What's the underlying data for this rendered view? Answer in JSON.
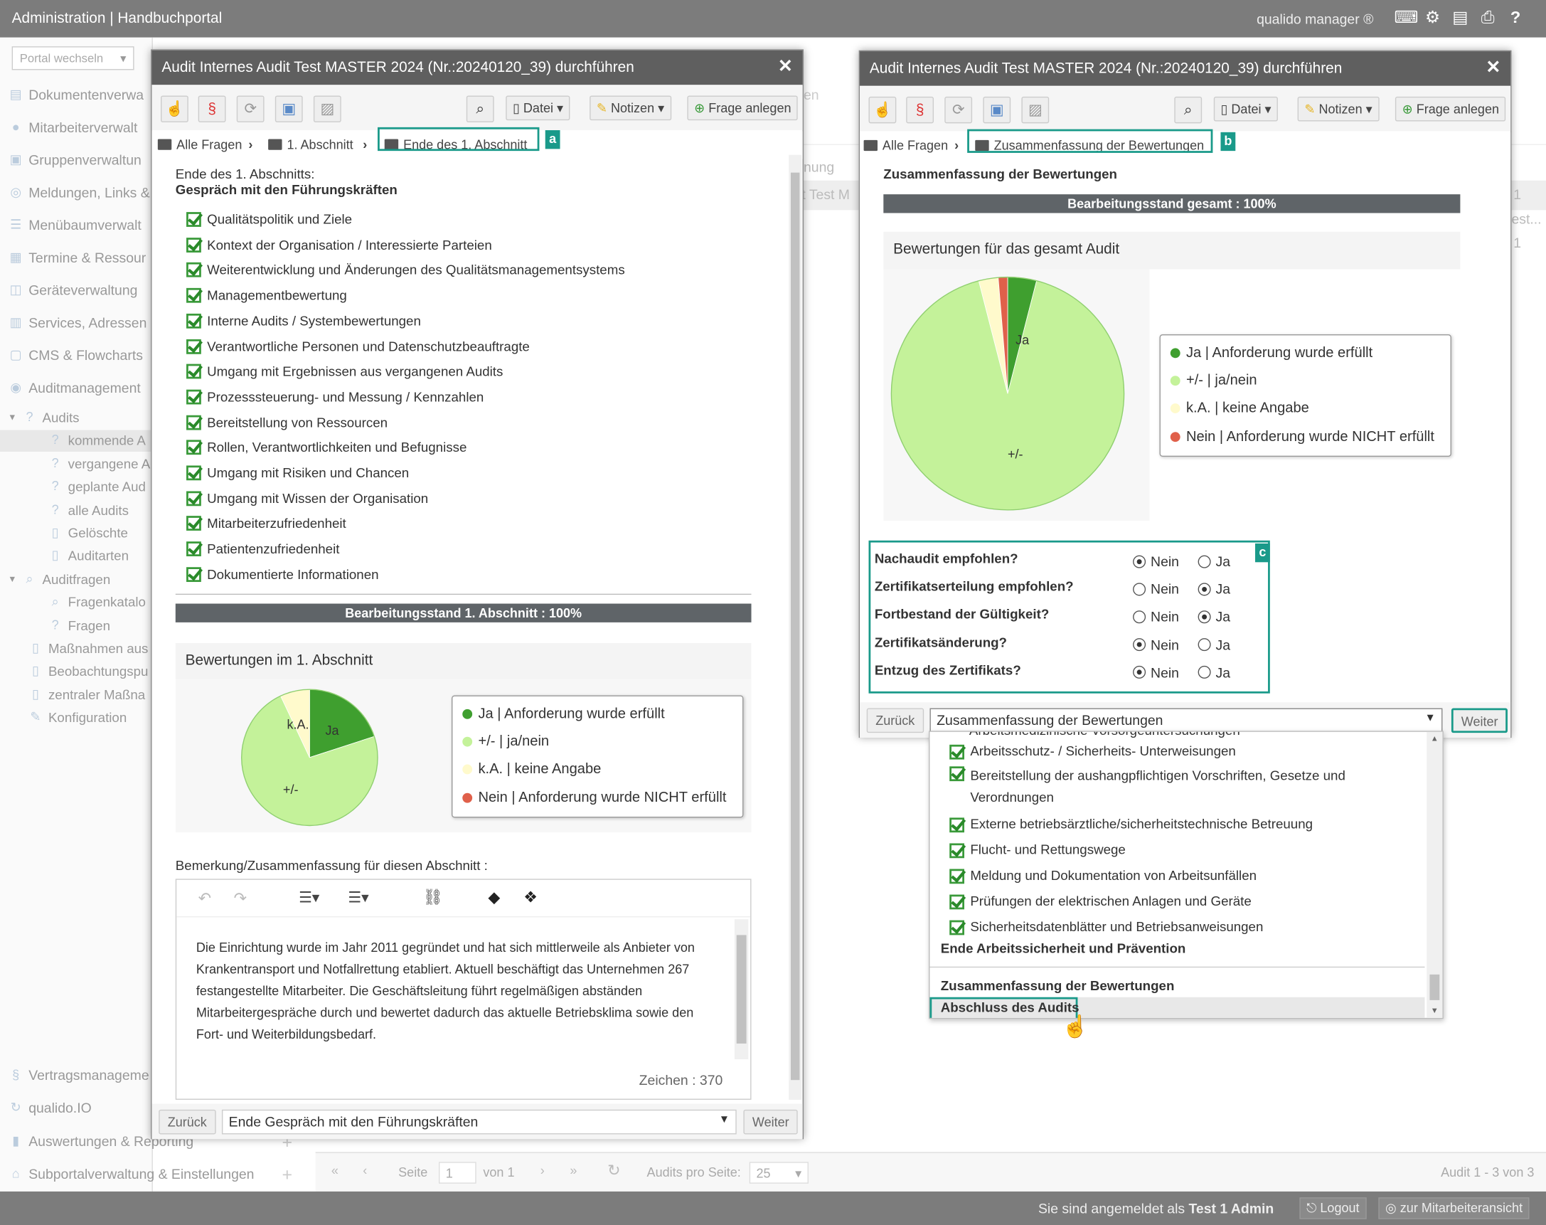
{
  "app": {
    "title": "Administration | Handbuchportal",
    "brand": "qualido manager ®"
  },
  "sidebar": {
    "portal_select": "Portal wechseln",
    "items": [
      "Dokumentenverwa",
      "Mitarbeiterverwalt",
      "Gruppenverwaltun",
      "Meldungen, Links &",
      "Menübaumverwalt",
      "Termine & Ressour",
      "Geräteverwaltung",
      "Services, Adressen",
      "CMS & Flowcharts",
      "Auditmanagement"
    ],
    "audits": "Audits",
    "audit_subs": [
      "kommende A",
      "vergangene A",
      "geplante Aud",
      "alle Audits",
      "Gelöschte",
      "Auditarten"
    ],
    "auditfragen": "Auditfragen",
    "auditfragen_subs": [
      "Fragenkatalo",
      "Fragen"
    ],
    "more": [
      "Maßnahmen aus",
      "Beobachtungspu",
      "zentraler Maßna",
      "Konfiguration"
    ],
    "bottom": [
      "Vertragsmanageme",
      "qualido.IO",
      "Auswertungen & Reporting",
      "Subportalverwaltung & Einstellungen"
    ]
  },
  "background": {
    "col_hint": "nung",
    "cell_hint": "it Test M",
    "num1": "1",
    "text2": "est...",
    "num2": "1",
    "ghost": "en"
  },
  "pager": {
    "seite": "Seite",
    "page": "1",
    "von": "von 1",
    "per_page_label": "Audits pro Seite:",
    "per_page": "25",
    "summary": "Audit 1 - 3 von 3"
  },
  "statusbar": {
    "login_prefix": "Sie sind angemeldet als",
    "user": "Test 1 Admin",
    "logout": "Logout",
    "employee_view": "zur Mitarbeiteransicht"
  },
  "dialog_left": {
    "title": "Audit Internes Audit Test MASTER 2024 (Nr.:20240120_39) durchführen",
    "toolbar": {
      "datei": "Datei",
      "notizen": "Notizen",
      "frage_anlegen": "Frage anlegen"
    },
    "crumbs": [
      "Alle Fragen",
      "1. Abschnitt",
      "Ende des 1. Abschnitt"
    ],
    "badge": "a",
    "heading1": "Ende des 1. Abschnitts:",
    "heading2": "Gespräch mit den Führungskräften",
    "checklist": [
      "Qualitätspolitik und Ziele",
      "Kontext der Organisation / Interessierte Parteien",
      "Weiterentwicklung und Änderungen des Qualitätsmanagementsystems",
      "Managementbewertung",
      "Interne Audits / Systembewertungen",
      "Verantwortliche Personen und Datenschutzbeauftragte",
      "Umgang mit Ergebnissen aus vergangenen Audits",
      "Prozesssteuerung- und Messung / Kennzahlen",
      "Bereitstellung von Ressourcen",
      "Rollen, Verantwortlichkeiten und Befugnisse",
      "Umgang mit Risiken und Chancen",
      "Umgang mit Wissen der Organisation",
      "Mitarbeiterzufriedenheit",
      "Patientenzufriedenheit",
      "Dokumentierte Informationen"
    ],
    "progress": "Bearbeitungsstand 1. Abschnitt : 100%",
    "ratings_head": "Bewertungen im 1. Abschnitt",
    "remark_label": "Bemerkung/Zusammenfassung für diesen Abschnitt :",
    "remark_text": "Die Einrichtung wurde im Jahr 2011 gegründet und hat sich mittlerweile als Anbieter von Krankentransport und Notfallrettung etabliert. Aktuell beschäftigt das Unternehmen 267 festangestellte Mitarbeiter. Die Geschäftsleitung führt regelmäßigen abständen Mitarbeitergespräche durch und bewertet dadurch das aktuelle Betriebsklima sowie den Fort- und Weiterbildungsbedarf.",
    "char_count": "Zeichen : 370",
    "back": "Zurück",
    "select": "Ende Gespräch mit den Führungskräften",
    "next": "Weiter"
  },
  "dialog_right": {
    "title": "Audit Internes Audit Test MASTER 2024 (Nr.:20240120_39) durchführen",
    "toolbar": {
      "datei": "Datei",
      "notizen": "Notizen",
      "frage_anlegen": "Frage anlegen"
    },
    "crumbs": [
      "Alle Fragen",
      "Zusammenfassung der Bewertungen"
    ],
    "badge_b": "b",
    "heading": "Zusammenfassung der Bewertungen",
    "progress": "Bearbeitungsstand gesamt : 100%",
    "ratings_head": "Bewertungen für das gesamt Audit",
    "badge_c": "c",
    "questions": [
      {
        "label": "Nachaudit empfohlen?",
        "no": "Nein",
        "yes": "Ja",
        "selected": "no"
      },
      {
        "label": "Zertifikatserteilung empfohlen?",
        "no": "Nein",
        "yes": "Ja",
        "selected": "yes"
      },
      {
        "label": "Fortbestand der Gültigkeit?",
        "no": "Nein",
        "yes": "Ja",
        "selected": "yes"
      },
      {
        "label": "Zertifikatsänderung?",
        "no": "Nein",
        "yes": "Ja",
        "selected": "no"
      },
      {
        "label": "Entzug des Zertifikats?",
        "no": "Nein",
        "yes": "Ja",
        "selected": "no"
      }
    ],
    "back": "Zurück",
    "select": "Zusammenfassung der Bewertungen",
    "next": "Weiter"
  },
  "dropdown": {
    "partial_top": "Arbeitsmedizinische Vorsorgeuntersuchungen",
    "items": [
      "Arbeitsschutz- / Sicherheits- Unterweisungen",
      "Bereitstellung der aushangpflichtigen Vorschriften, Gesetze und Verordnungen",
      "Externe betriebsärztliche/sicherheitstechnische Betreuung",
      "Flucht- und Rettungswege",
      "Meldung und Dokumentation von Arbeitsunfällen",
      "Prüfungen der elektrischen Anlagen und Geräte",
      "Sicherheitsdatenblätter und Betriebsanweisungen"
    ],
    "group_end": "Ende Arbeitssicherheit und Prävention",
    "summary": "Zusammenfassung der Bewertungen",
    "final": "Abschluss des Audits"
  },
  "chart_data": [
    {
      "type": "pie",
      "title": "Bewertungen im 1. Abschnitt",
      "categories": [
        "Ja | Anforderung wurde erfüllt",
        "+/- | ja/nein",
        "k.A. | keine Angabe",
        "Nein | Anforderung wurde NICHT erfüllt"
      ],
      "values": [
        20,
        73,
        7,
        0
      ],
      "slice_labels": [
        "Ja",
        "+/-",
        "k.A.",
        ""
      ],
      "colors": [
        "#3f9f2f",
        "#c4f29a",
        "#fffacc",
        "#e0604a"
      ],
      "legend": "right"
    },
    {
      "type": "pie",
      "title": "Bewertungen für das gesamt Audit",
      "categories": [
        "Ja | Anforderung wurde erfüllt",
        "+/- | ja/nein",
        "k.A. | keine Angabe",
        "Nein | Anforderung wurde NICHT erfüllt"
      ],
      "values": [
        4,
        92,
        2.7,
        1.3
      ],
      "slice_labels": [
        "Ja",
        "+/-",
        "",
        ""
      ],
      "colors": [
        "#3f9f2f",
        "#c4f29a",
        "#fffacc",
        "#e0604a"
      ],
      "legend": "right"
    }
  ]
}
